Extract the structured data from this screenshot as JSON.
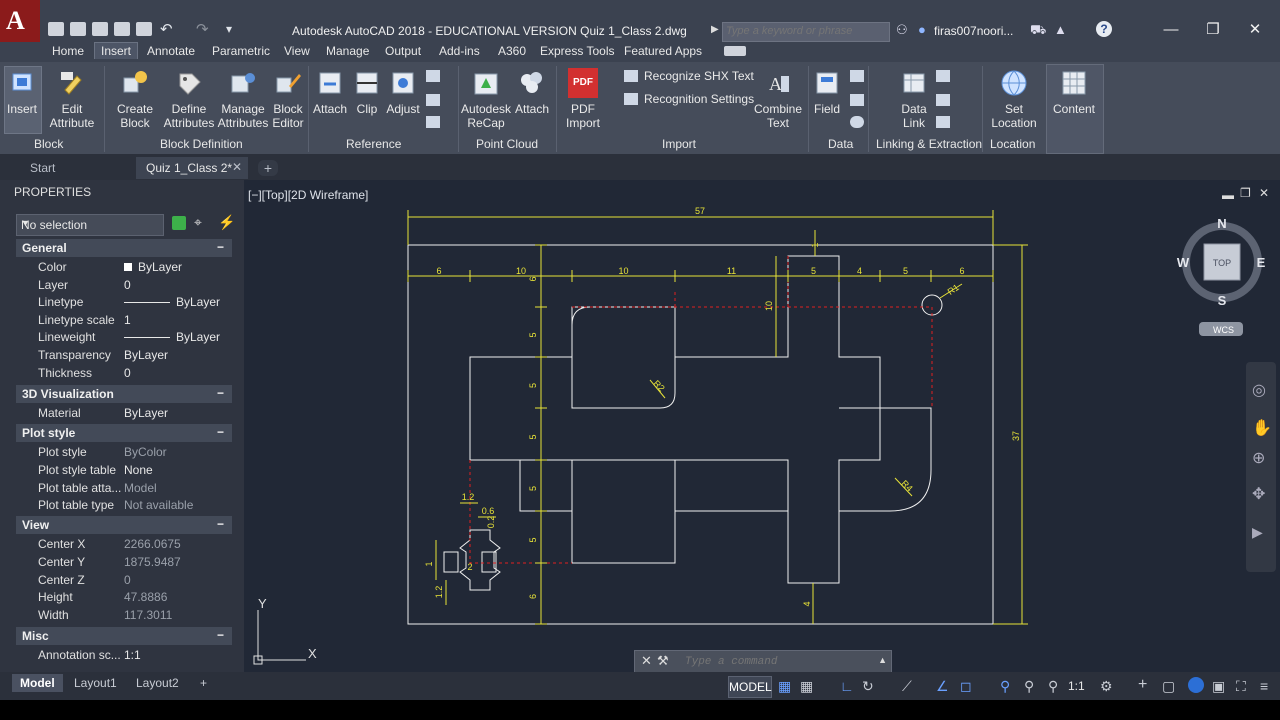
{
  "titlebar": {
    "title": "Autodesk AutoCAD 2018 - EDUCATIONAL VERSION    Quiz 1_Class 2.dwg",
    "search_placeholder": "Type a keyword or phrase",
    "user": "firas007noori...",
    "app_logo": "A"
  },
  "menu_tabs": [
    "Home",
    "Insert",
    "Annotate",
    "Parametric",
    "View",
    "Manage",
    "Output",
    "Add-ins",
    "A360",
    "Express Tools",
    "Featured Apps"
  ],
  "ribbon": {
    "insert": "Insert",
    "edit_attribute": [
      "Edit",
      "Attribute"
    ],
    "create_block": [
      "Create",
      "Block"
    ],
    "define_attributes": [
      "Define",
      "Attributes"
    ],
    "manage_attributes": [
      "Manage",
      "Attributes"
    ],
    "block_editor": [
      "Block",
      "Editor"
    ],
    "attach": "Attach",
    "clip": "Clip",
    "adjust": "Adjust",
    "autodesk_recap": [
      "Autodesk",
      "ReCap"
    ],
    "attach2": "Attach",
    "pdf_import": [
      "PDF",
      "Import"
    ],
    "pdf_icon_text": "PDF",
    "recognize_shx": "Recognize SHX Text",
    "recognition_settings": "Recognition Settings",
    "combine_text": [
      "Combine",
      "Text"
    ],
    "field": "Field",
    "data_link": [
      "Data",
      "Link"
    ],
    "set_location": [
      "Set",
      "Location"
    ],
    "content": "Content",
    "panels": {
      "block": "Block",
      "block_definition": "Block Definition",
      "reference": "Reference",
      "point_cloud": "Point Cloud",
      "import": "Import",
      "data": "Data",
      "linking": "Linking & Extraction",
      "location": "Location"
    }
  },
  "doc_tabs": [
    "Start",
    "Quiz 1_Class 2*"
  ],
  "properties": {
    "title": "PROPERTIES",
    "selection": "No selection",
    "sections": {
      "general": "General",
      "viz": "3D Visualization",
      "plot": "Plot style",
      "view": "View",
      "misc": "Misc"
    },
    "general": [
      {
        "label": "Color",
        "value": "ByLayer"
      },
      {
        "label": "Layer",
        "value": "0"
      },
      {
        "label": "Linetype",
        "value": "ByLayer"
      },
      {
        "label": "Linetype scale",
        "value": "1"
      },
      {
        "label": "Lineweight",
        "value": "ByLayer"
      },
      {
        "label": "Transparency",
        "value": "ByLayer"
      },
      {
        "label": "Thickness",
        "value": "0"
      }
    ],
    "viz": [
      {
        "label": "Material",
        "value": "ByLayer"
      }
    ],
    "plot": [
      {
        "label": "Plot style",
        "value": "ByColor"
      },
      {
        "label": "Plot style table",
        "value": "None"
      },
      {
        "label": "Plot table atta...",
        "value": "Model"
      },
      {
        "label": "Plot table type",
        "value": "Not available"
      }
    ],
    "view": [
      {
        "label": "Center X",
        "value": "2266.0675"
      },
      {
        "label": "Center Y",
        "value": "1875.9487"
      },
      {
        "label": "Center Z",
        "value": "0"
      },
      {
        "label": "Height",
        "value": "47.8886"
      },
      {
        "label": "Width",
        "value": "117.3011"
      }
    ],
    "misc": [
      {
        "label": "Annotation sc...",
        "value": "1:1"
      }
    ]
  },
  "viewport": {
    "label": "[−][Top][2D Wireframe]",
    "viewcube": {
      "n": "N",
      "s": "S",
      "e": "E",
      "w": "W",
      "top": "TOP",
      "wcs": "WCS"
    },
    "ucs": {
      "x": "X",
      "y": "Y"
    },
    "dims": {
      "d57": "57",
      "d37": "37",
      "top_row": [
        "6",
        "10",
        "10",
        "11",
        "5",
        "4",
        "5",
        "6"
      ],
      "left_col": [
        "6",
        "5",
        "5",
        "5",
        "5",
        "5",
        "6"
      ],
      "d10": "10",
      "d1": "1",
      "d4": "4",
      "r1": "R1",
      "r2": "R2",
      "r4": "R4",
      "small": [
        "1.2",
        "0.6",
        "0.2",
        "2",
        "1",
        "1.2"
      ]
    }
  },
  "command": {
    "placeholder": "Type a command"
  },
  "layout_tabs": [
    "Model",
    "Layout1",
    "Layout2"
  ],
  "status": {
    "model": "MODEL",
    "scale": "1:1"
  },
  "colors": {
    "accent": "#e8e338",
    "hidden": "#e02020",
    "geometry": "#f0f0f0",
    "background": "#212836"
  }
}
